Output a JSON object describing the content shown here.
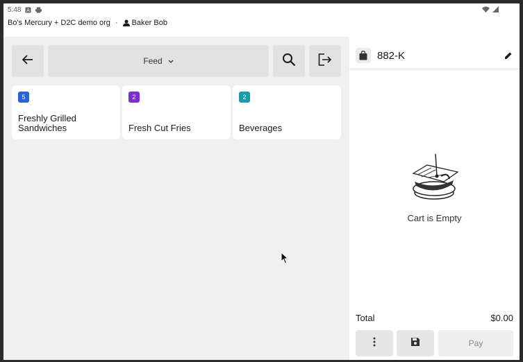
{
  "status_bar": {
    "time": "5:48"
  },
  "header": {
    "org_name": "Bo's Mercury + D2C demo org",
    "separator": "·",
    "user_name": "Baker Bob"
  },
  "menu": {
    "category_selected": "Feed",
    "categories": [
      {
        "count": "5",
        "label": "Freshly Grilled Sandwiches",
        "badge_color": "#2962d6"
      },
      {
        "count": "2",
        "label": "Fresh Cut Fries",
        "badge_color": "#7b2fd0"
      },
      {
        "count": "2",
        "label": "Beverages",
        "badge_color": "#1a9aaa"
      }
    ]
  },
  "order": {
    "id": "882-K",
    "empty_text": "Cart is Empty",
    "total_label": "Total",
    "total_value": "$0.00",
    "pay_label": "Pay"
  },
  "icons": {
    "back": "arrow-left-icon",
    "search": "search-icon",
    "exit": "logout-icon",
    "bag": "shopping-bag-icon",
    "edit": "pencil-icon",
    "more": "more-vertical-icon",
    "save": "save-icon"
  }
}
